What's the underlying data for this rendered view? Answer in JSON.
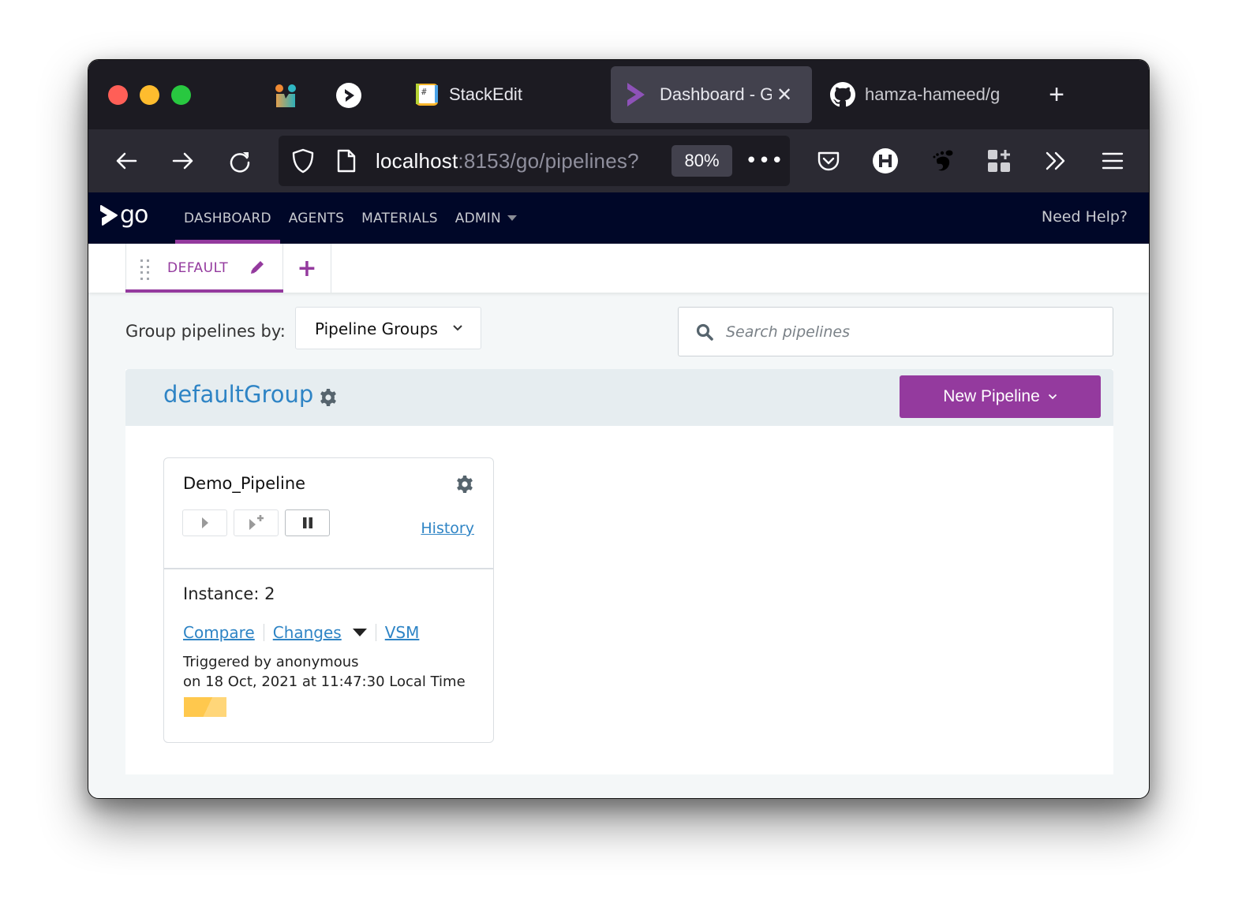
{
  "browser": {
    "pinned_tabs": [
      {
        "icon": "app-logo-icon",
        "label": ""
      },
      {
        "icon": "gocd-icon",
        "label": ""
      }
    ],
    "tabs": [
      {
        "label": "StackEdit",
        "icon": "stackedit-icon",
        "active": false
      },
      {
        "label": "Dashboard - G",
        "icon": "gocd-icon",
        "active": true
      },
      {
        "label": "hamza-hameed/g",
        "icon": "github-icon",
        "active": false
      }
    ],
    "new_tab_label": "+",
    "url_host": "localhost",
    "url_rest": ":8153/go/pipelines?",
    "zoom_level": "80%",
    "toolbar_icons": [
      "pocket-icon",
      "honey-h-icon",
      "gnome-foot-icon",
      "extensions-icon",
      "overflow-icon",
      "menu-icon"
    ]
  },
  "app": {
    "logo_text": "go",
    "nav": [
      {
        "label": "DASHBOARD",
        "active": true
      },
      {
        "label": "AGENTS",
        "active": false
      },
      {
        "label": "MATERIALS",
        "active": false
      },
      {
        "label": "ADMIN",
        "active": false,
        "has_dropdown": true
      }
    ],
    "help_label": "Need Help?",
    "accent_color": "#943a9e",
    "link_color": "#2e84c5"
  },
  "dashboard": {
    "tabs": [
      {
        "label": "DEFAULT",
        "active": true
      }
    ],
    "add_tab_label": "+",
    "group_by_label": "Group pipelines by:",
    "group_by_value": "Pipeline Groups",
    "search_placeholder": "Search pipelines",
    "search_value": ""
  },
  "group": {
    "name": "defaultGroup",
    "new_pipeline_label": "New Pipeline",
    "pipelines": [
      {
        "name": "Demo_Pipeline",
        "history_label": "History",
        "instance_label": "Instance: 2",
        "links": [
          "Compare",
          "Changes",
          "VSM"
        ],
        "triggered_by": "Triggered by anonymous",
        "triggered_on": "on 18 Oct, 2021 at 11:47:30 Local Time",
        "stages": [
          {
            "status": "building",
            "color": "#ffc84d"
          }
        ]
      }
    ]
  }
}
